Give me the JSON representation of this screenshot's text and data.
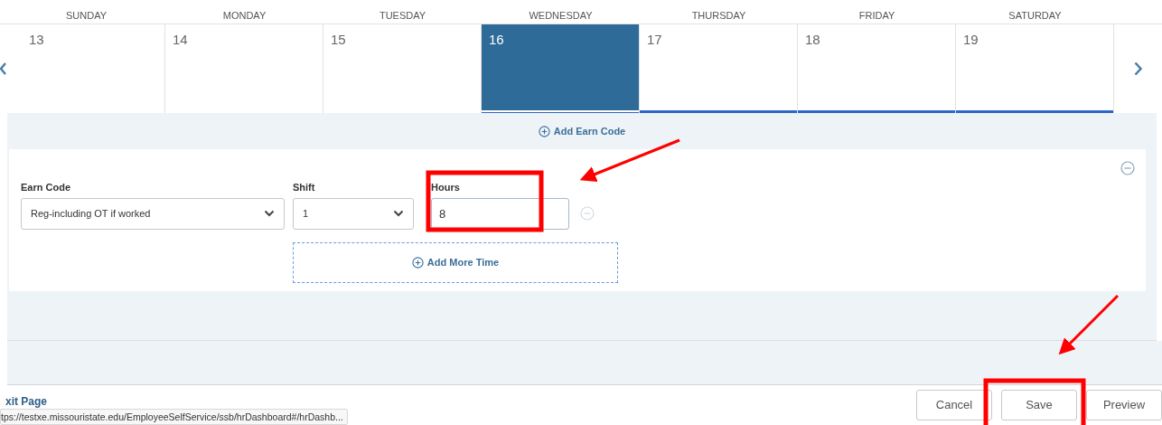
{
  "week": {
    "days": [
      {
        "name": "SUNDAY",
        "date": "13",
        "selected": false,
        "underlined": false
      },
      {
        "name": "MONDAY",
        "date": "14",
        "selected": false,
        "underlined": false
      },
      {
        "name": "TUESDAY",
        "date": "15",
        "selected": false,
        "underlined": false
      },
      {
        "name": "WEDNESDAY",
        "date": "16",
        "selected": true,
        "underlined": true
      },
      {
        "name": "THURSDAY",
        "date": "17",
        "selected": false,
        "underlined": true
      },
      {
        "name": "FRIDAY",
        "date": "18",
        "selected": false,
        "underlined": true
      },
      {
        "name": "SATURDAY",
        "date": "19",
        "selected": false,
        "underlined": true
      }
    ]
  },
  "add_earn_code": "Add Earn Code",
  "entry": {
    "earn_code": {
      "label": "Earn Code",
      "value": "Reg-including OT if worked"
    },
    "shift": {
      "label": "Shift",
      "value": "1"
    },
    "hours": {
      "label": "Hours",
      "value": "8"
    },
    "add_more_time": "Add More Time"
  },
  "footer": {
    "exit_link": "xit Page",
    "buttons": [
      "Cancel",
      "Save",
      "Preview"
    ],
    "status_url": "tps://testxe.missouristate.edu/EmployeeSelfService/ssb/hrDashboard#/hrDashb..."
  }
}
